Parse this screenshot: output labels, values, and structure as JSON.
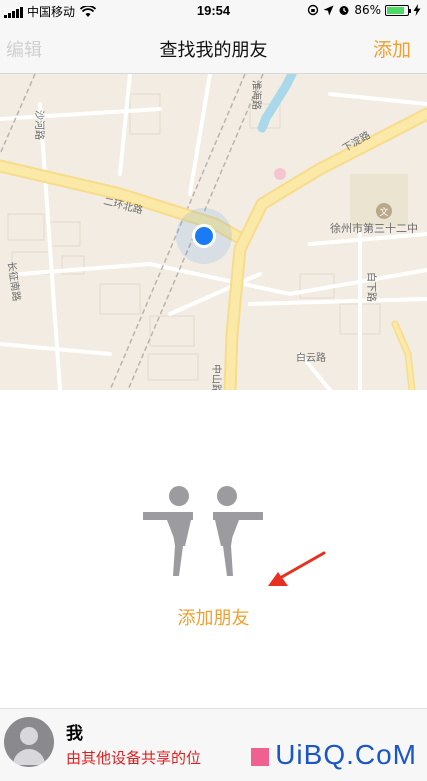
{
  "status_bar": {
    "carrier": "中国移动",
    "time": "19:54",
    "battery": "86%",
    "battery_level": 0.86
  },
  "nav": {
    "edit_label": "编辑",
    "title": "查找我的朋友",
    "add_label": "添加"
  },
  "map": {
    "roads": {
      "erhuan_north": "二环北路",
      "xiajin": "下淀路",
      "changzheng_south": "长征南路",
      "baiyun": "白云路",
      "zhongshan": "中山路",
      "huaihai": "淮海路",
      "baixia": "白下路",
      "shanghe": "沙河路"
    },
    "poi": "徐州市第三十二中",
    "location_dot_color": "#1a7cf5"
  },
  "empty_state": {
    "add_friends_label": "添加朋友"
  },
  "me": {
    "name": "我",
    "subtitle": "由其他设备共享的位"
  },
  "watermark": "UiBQ.CoM",
  "colors": {
    "accent": "#f0a030",
    "alert_text": "#e02020",
    "annotation_arrow": "#e83020"
  }
}
